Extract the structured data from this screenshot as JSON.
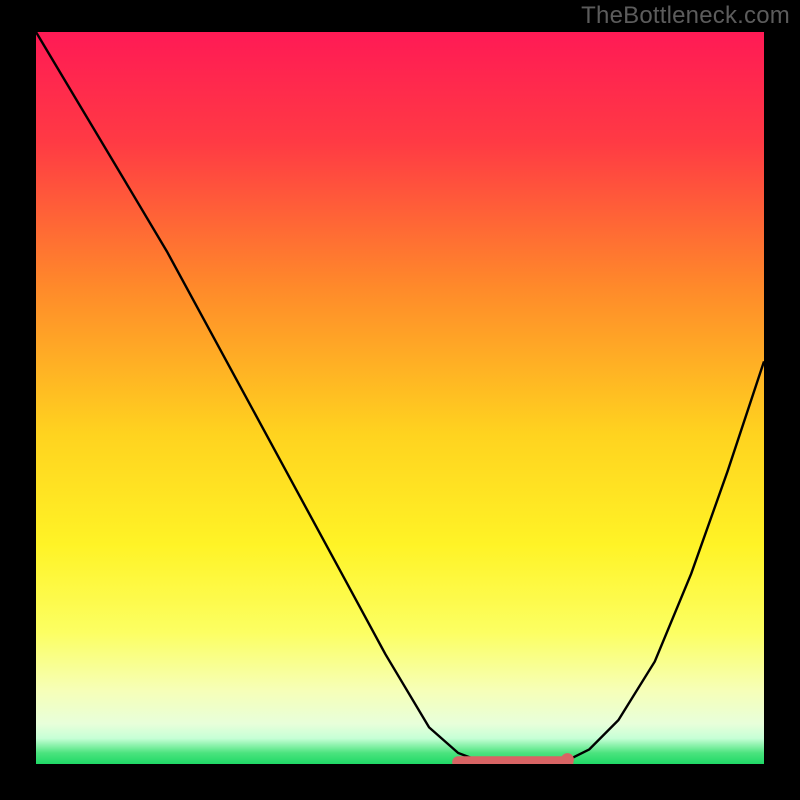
{
  "watermark_text": "TheBottleneck.com",
  "colors": {
    "frame": "#000000",
    "watermark": "#5c5c5c",
    "curve": "#000000",
    "valley_marker": "#d86464",
    "gradient_stops": [
      {
        "offset": 0,
        "color": "#ff1a55"
      },
      {
        "offset": 0.15,
        "color": "#ff3a44"
      },
      {
        "offset": 0.35,
        "color": "#ff8a2a"
      },
      {
        "offset": 0.55,
        "color": "#ffd31f"
      },
      {
        "offset": 0.7,
        "color": "#fff326"
      },
      {
        "offset": 0.82,
        "color": "#fcff62"
      },
      {
        "offset": 0.9,
        "color": "#f6ffb8"
      },
      {
        "offset": 0.945,
        "color": "#e8ffda"
      },
      {
        "offset": 0.965,
        "color": "#c6ffd6"
      },
      {
        "offset": 0.985,
        "color": "#4be37e"
      },
      {
        "offset": 1.0,
        "color": "#1fd966"
      }
    ]
  },
  "chart_data": {
    "type": "line",
    "title": "",
    "xlabel": "",
    "ylabel": "",
    "xlim": [
      0,
      1
    ],
    "ylim": [
      0,
      1
    ],
    "series": [
      {
        "name": "bottleneck-curve",
        "x": [
          0.0,
          0.06,
          0.12,
          0.18,
          0.24,
          0.3,
          0.36,
          0.42,
          0.48,
          0.54,
          0.58,
          0.62,
          0.68,
          0.73,
          0.76,
          0.8,
          0.85,
          0.9,
          0.95,
          1.0
        ],
        "y": [
          1.0,
          0.9,
          0.8,
          0.7,
          0.59,
          0.48,
          0.37,
          0.26,
          0.15,
          0.05,
          0.015,
          0.0,
          0.0,
          0.005,
          0.02,
          0.06,
          0.14,
          0.26,
          0.4,
          0.55
        ]
      }
    ],
    "valley": {
      "x_start": 0.58,
      "x_end": 0.73,
      "y": 0.0025
    },
    "valley_dot": {
      "x": 0.73,
      "y": 0.006
    }
  }
}
